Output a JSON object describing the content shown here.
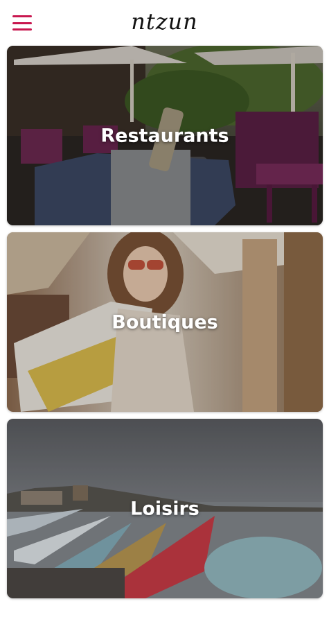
{
  "app": {
    "logo_text": "ntzun",
    "menu_icon": "hamburger-menu-icon",
    "accent_color": "#c8174f"
  },
  "categories": [
    {
      "label": "Restaurants"
    },
    {
      "label": "Boutiques"
    },
    {
      "label": "Loisirs"
    }
  ]
}
